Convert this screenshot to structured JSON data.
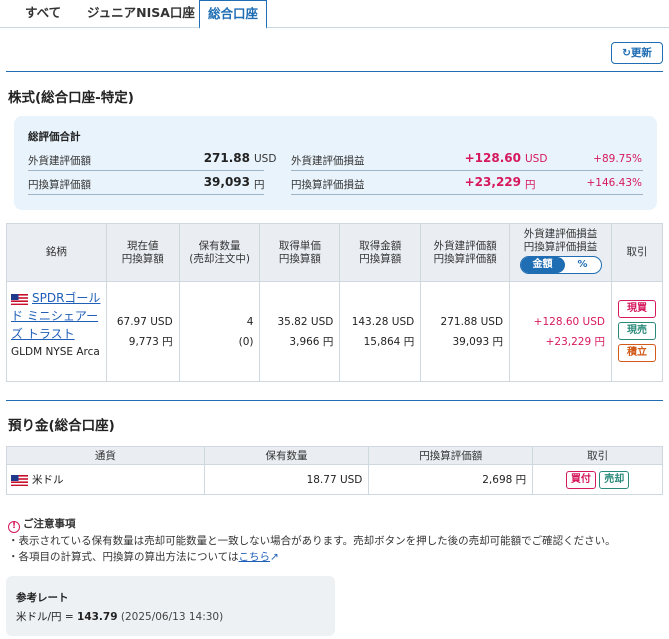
{
  "tabs": [
    "すべて",
    "ジュニアNISA口座",
    "総合口座"
  ],
  "refresh_label": "更新",
  "stock_section": {
    "title": "株式(総合口座-特定)",
    "summary": {
      "heading": "総評価合計",
      "foreign_value_label": "外貨建評価額",
      "foreign_value": "271.88",
      "foreign_unit": "USD",
      "yen_value_label": "円換算評価額",
      "yen_value": "39,093",
      "yen_unit": "円",
      "foreign_pl_label": "外貨建評価損益",
      "foreign_pl": "+128.60",
      "foreign_pl_unit": "USD",
      "foreign_pl_pct": "+89.75%",
      "yen_pl_label": "円換算評価損益",
      "yen_pl": "+23,229",
      "yen_pl_unit": "円",
      "yen_pl_pct": "+146.43%"
    },
    "headers": {
      "name": "銘柄",
      "price_1": "現在値",
      "price_2": "円換算額",
      "qty_1": "保有数量",
      "qty_2": "(売却注文中)",
      "cost_1": "取得単価",
      "cost_2": "円換算額",
      "amount_1": "取得金額",
      "amount_2": "円換算額",
      "value_1": "外貨建評価額",
      "value_2": "円換算評価額",
      "pl_1": "外貨建評価損益",
      "pl_2": "円換算評価損益",
      "toggle_amount": "金額",
      "toggle_pct": "%",
      "trade": "取引"
    },
    "row": {
      "name": "SPDRゴールド ミニシェアーズ トラスト",
      "ticker": "GLDM NYSE Arca",
      "price": "67.97 USD",
      "price_yen": "9,773 円",
      "qty": "4",
      "qty_selling": "(0)",
      "cost": "35.82 USD",
      "cost_yen": "3,966 円",
      "amount": "143.28 USD",
      "amount_yen": "15,864 円",
      "value": "271.88 USD",
      "value_yen": "39,093 円",
      "pl": "+128.60 USD",
      "pl_yen": "+23,229 円",
      "btn_spot_buy": "現買",
      "btn_spot_sell": "現売",
      "btn_accumulate": "積立"
    }
  },
  "deposit_section": {
    "title": "預り金(総合口座)",
    "headers": {
      "currency": "通貨",
      "qty": "保有数量",
      "yen": "円換算評価額",
      "trade": "取引"
    },
    "row": {
      "currency": "米ドル",
      "qty": "18.77 USD",
      "yen": "2,698 円",
      "btn_buy": "買付",
      "btn_sell": "売却"
    }
  },
  "notes": {
    "title": "ご注意事項",
    "line1": "・表示されている保有数量は売却可能数量と一致しない場合があります。売却ボタンを押した後の売却可能額でご確認ください。",
    "line2_prefix": "・各項目の計算式、円換算の算出方法については",
    "line2_link": "こちら"
  },
  "rate": {
    "title": "参考レート",
    "label": "米ドル/円 = ",
    "value": "143.79",
    "timestamp": "(2025/06/13 14:30)"
  }
}
